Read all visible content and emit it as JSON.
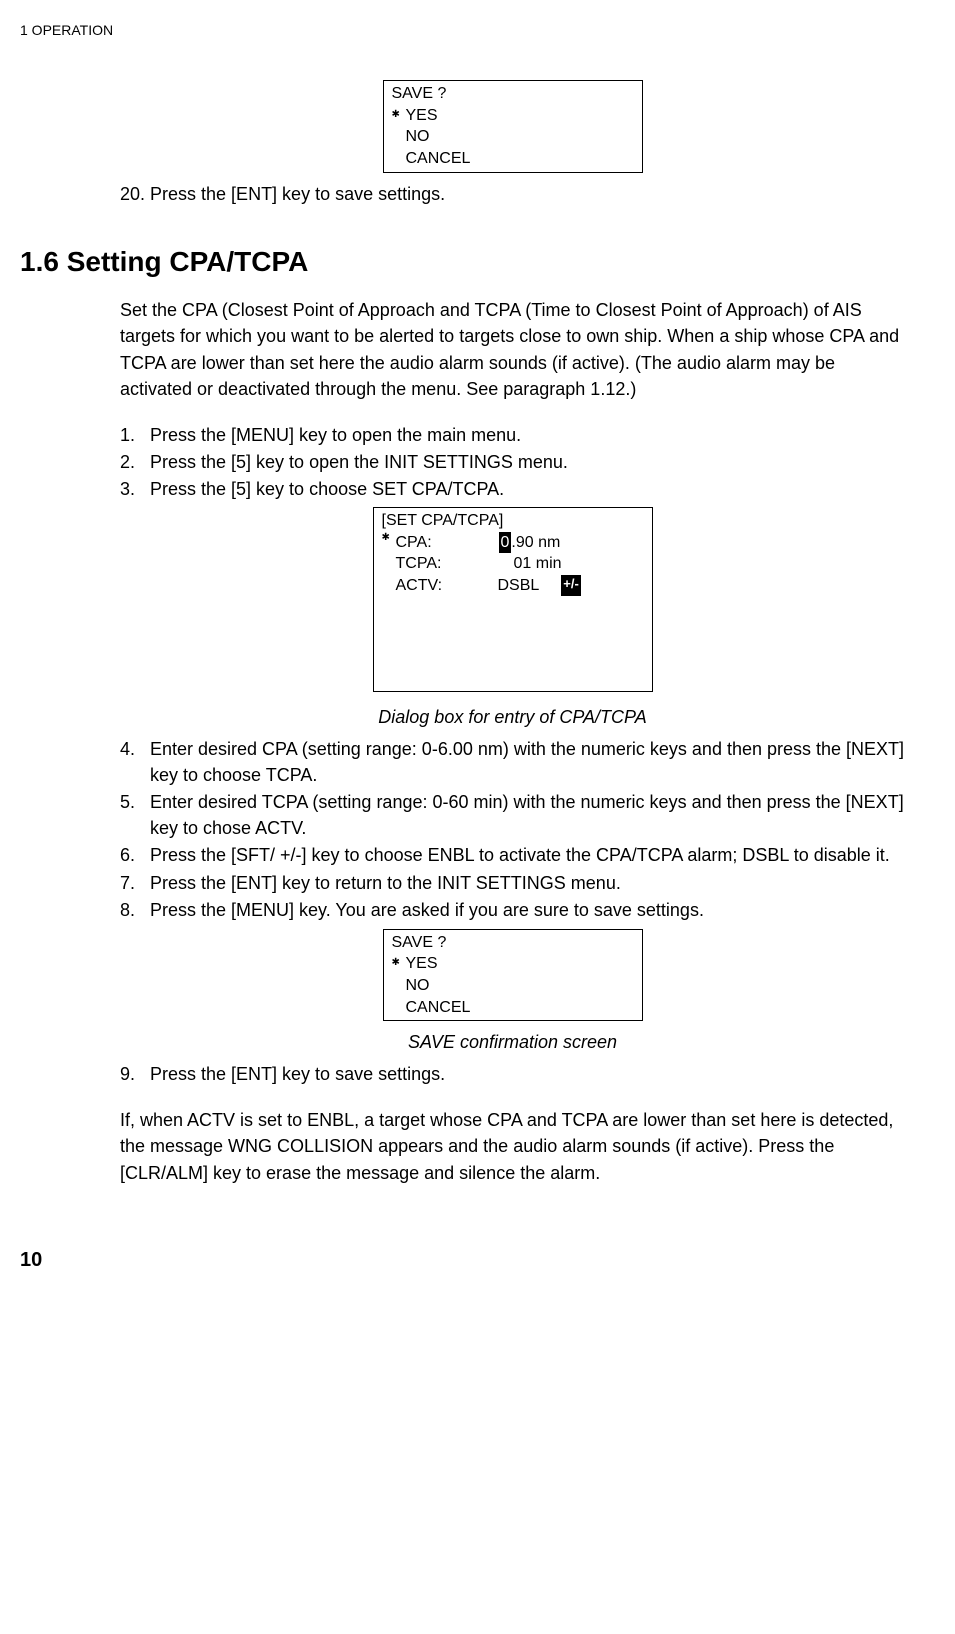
{
  "header": "1    OPERATION",
  "save_box": {
    "title": "SAVE ?",
    "yes": "YES",
    "no": "NO",
    "cancel": "CANCEL"
  },
  "step20": "20. Press the [ENT] key to save settings.",
  "heading": "1.6 Setting CPA/TCPA",
  "intro": "Set the CPA (Closest Point of Approach and TCPA (Time to Closest Point of Approach) of AIS targets for which you want to be alerted to targets close to own ship. When a ship whose CPA and TCPA are lower than set here the audio alarm sounds (if active). (The audio alarm may be activated or deactivated through the menu. See paragraph 1.12.)",
  "steps_a": {
    "s1": "Press the [MENU] key to open the main menu.",
    "s2": "Press the [5] key to open the INIT SETTINGS menu.",
    "s3": "Press the [5] key to choose SET CPA/TCPA."
  },
  "cpa_box": {
    "title": "[SET CPA/TCPA]",
    "row1_label": "CPA:",
    "row1_val_pre": "0",
    "row1_val_post": ".90 nm",
    "row2_label": "TCPA:",
    "row2_val": "01 min",
    "row3_label": "ACTV:",
    "row3_val": "DSBL",
    "row3_pm": "+/-"
  },
  "caption1": "Dialog box for entry of CPA/TCPA",
  "steps_b": {
    "s4": "Enter desired CPA (setting range: 0-6.00 nm) with the numeric keys and then press the [NEXT] key to choose TCPA.",
    "s5": "Enter desired TCPA (setting range: 0-60 min) with the numeric keys and then press the [NEXT] key to chose ACTV.",
    "s6": "Press the [SFT/ +/-] key to choose ENBL to activate the CPA/TCPA alarm; DSBL to disable it.",
    "s7": "Press the [ENT] key to return to the INIT SETTINGS menu.",
    "s8": "Press the [MENU] key. You are asked if you are sure to save settings."
  },
  "caption2": "SAVE confirmation screen",
  "steps_c": {
    "s9": "Press the [ENT] key to save settings."
  },
  "outro": "If, when ACTV is set to ENBL, a target whose CPA and TCPA are lower than set here is detected, the message WNG COLLISION appears and the audio alarm sounds (if active). Press the [CLR/ALM] key to erase the message and silence the alarm.",
  "pagenum": "10"
}
